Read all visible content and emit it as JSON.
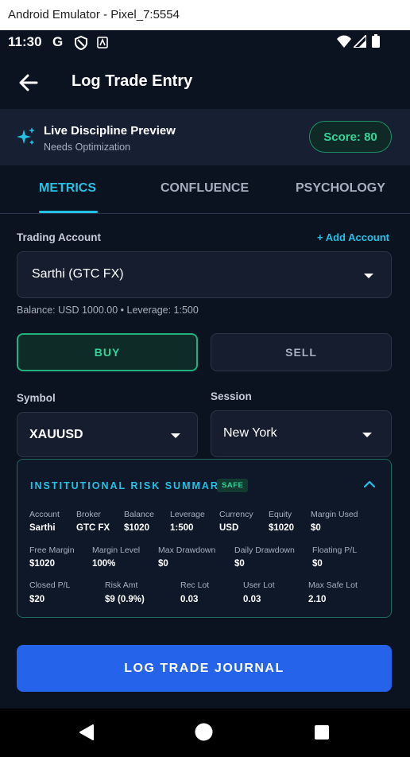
{
  "window": {
    "title": "Android Emulator - Pixel_7:5554"
  },
  "status_bar": {
    "time": "11:30",
    "google_glyph": "G"
  },
  "app_bar": {
    "title": "Log Trade Entry",
    "back_icon": "arrow-left-icon"
  },
  "preview": {
    "title": "Live Discipline Preview",
    "subtitle": "Needs Optimization",
    "score_label": "Score: 80",
    "icon": "sparkle-icon"
  },
  "tabs": [
    {
      "label": "METRICS",
      "active": true
    },
    {
      "label": "CONFLUENCE",
      "active": false
    },
    {
      "label": "PSYCHOLOGY",
      "active": false
    }
  ],
  "form": {
    "account_label": "Trading Account",
    "add_account": "+ Add Account",
    "account_value": "Sarthi (GTC FX)",
    "account_info": "Balance: USD 1000.00  •  Leverage: 1:500",
    "buy_label": "BUY",
    "sell_label": "SELL",
    "selected_side": "BUY",
    "symbol_label": "Symbol",
    "symbol_value": "XAUUSD",
    "session_label": "Session",
    "session_value": "New York"
  },
  "risk_summary": {
    "title": "INSTITUTIONAL RISK SUMMARY",
    "badge": "SAFE",
    "rows": [
      [
        {
          "label": "Account",
          "value": "Sarthi"
        },
        {
          "label": "Broker",
          "value": "GTC FX"
        },
        {
          "label": "Balance",
          "value": "$1020"
        },
        {
          "label": "Leverage",
          "value": "1:500"
        },
        {
          "label": "Currency",
          "value": "USD"
        },
        {
          "label": "Equity",
          "value": "$1020"
        },
        {
          "label": "Margin Used",
          "value": "$0"
        }
      ],
      [
        {
          "label": "Free Margin",
          "value": "$1020"
        },
        {
          "label": "Margin Level",
          "value": "100%"
        },
        {
          "label": "Max Drawdown",
          "value": "$0"
        },
        {
          "label": "Daily Drawdown",
          "value": "$0"
        },
        {
          "label": "Floating P/L",
          "value": "$0"
        }
      ],
      [
        {
          "label": "Closed P/L",
          "value": "$20"
        },
        {
          "label": "Risk Amt",
          "value": "$9 (0.9%)"
        },
        {
          "label": "Rec Lot",
          "value": "0.03"
        },
        {
          "label": "User Lot",
          "value": "0.03"
        },
        {
          "label": "Max Safe Lot",
          "value": "2.10"
        }
      ]
    ]
  },
  "log_button": "LOG TRADE JOURNAL",
  "colors": {
    "accent": "#22c1e5",
    "positive": "#34d399",
    "primary_button": "#2563eb",
    "background": "#0b1220"
  }
}
